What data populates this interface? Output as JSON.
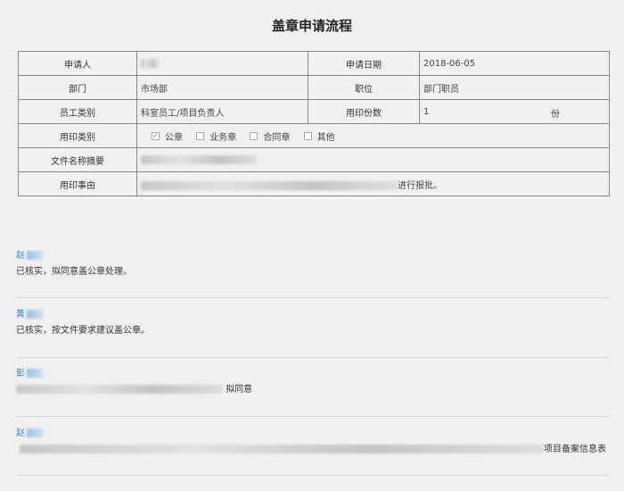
{
  "page_title": "盖章申请流程",
  "form": {
    "applicant_label": "申请人",
    "apply_date_label": "申请日期",
    "apply_date_value": "2018-06-05",
    "department_label": "部门",
    "department_value": "市场部",
    "position_label": "职位",
    "position_value": "部门职员",
    "staff_type_label": "员工类别",
    "staff_type_value": "科室员工/项目负责人",
    "copies_label": "用印份数",
    "copies_value": "1",
    "copies_unit": "份",
    "seal_type_label": "用印类别",
    "seal_options": [
      {
        "label": "公章",
        "checked": true
      },
      {
        "label": "业务章",
        "checked": false
      },
      {
        "label": "合同章",
        "checked": false
      },
      {
        "label": "其他",
        "checked": false
      }
    ],
    "doc_summary_label": "文件名称摘要",
    "reason_label": "用印事由",
    "reason_suffix": "进行报批。"
  },
  "opinions": [
    {
      "name": "赵",
      "text": "已核实，拟同意盖公章处理。"
    },
    {
      "name": "黄",
      "text": "已核实，按文件要求建议盖公章。"
    },
    {
      "name": "彭",
      "text": "拟同意"
    },
    {
      "name": "赵",
      "text": "项目备案信息表"
    }
  ]
}
